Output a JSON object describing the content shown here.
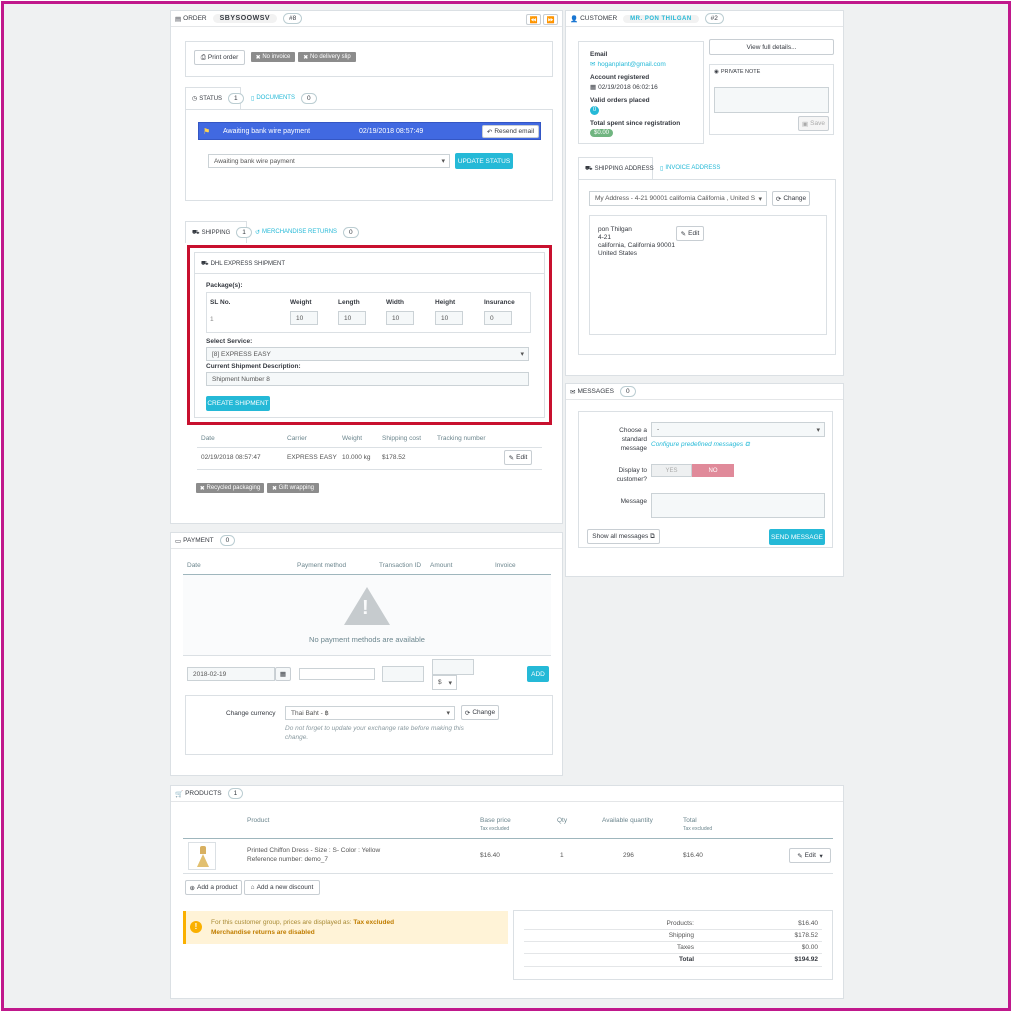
{
  "order": {
    "header_label": "ORDER",
    "reference": "SBYSOOWSV",
    "number": "#8",
    "print_label": "Print order",
    "no_invoice": "No invoice",
    "no_delivery": "No delivery slip",
    "tab_status": "STATUS",
    "tab_status_count": "1",
    "tab_documents": "DOCUMENTS",
    "tab_documents_count": "0",
    "status_name": "Awaiting bank wire payment",
    "status_date": "02/19/2018 08:57:49",
    "resend_label": "Resend email",
    "status_select": "Awaiting bank wire payment",
    "update_status_label": "UPDATE STATUS"
  },
  "shipping": {
    "tab_shipping": "SHIPPING",
    "tab_shipping_count": "1",
    "tab_returns": "MERCHANDISE RETURNS",
    "tab_returns_count": "0",
    "dhl_title": "DHL EXPRESS SHIPMENT",
    "packages_label": "Package(s):",
    "col_sl": "SL No.",
    "col_weight": "Weight",
    "col_length": "Length",
    "col_width": "Width",
    "col_height": "Height",
    "col_insurance": "Insurance",
    "row_sl": "1",
    "row_weight": "10",
    "row_length": "10",
    "row_width": "10",
    "row_height": "10",
    "row_insurance": "0",
    "select_service_label": "Select Service:",
    "service_value": "[8] EXPRESS EASY",
    "desc_label": "Current Shipment Description:",
    "desc_value": "Shipment Number 8",
    "create_label": "CREATE SHIPMENT",
    "table_headers": [
      "Date",
      "Carrier",
      "Weight",
      "Shipping cost",
      "Tracking number"
    ],
    "row_date": "02/19/2018 08:57:47",
    "row_carrier": "EXPRESS EASY",
    "row_weight_kg": "10.000 kg",
    "row_cost": "$178.52",
    "edit_label": "Edit",
    "recycled": "Recycled packaging",
    "gift": "Gift wrapping"
  },
  "payment": {
    "header_label": "PAYMENT",
    "count": "0",
    "headers": [
      "Date",
      "Payment method",
      "Transaction ID",
      "Amount",
      "Invoice"
    ],
    "empty_text": "No payment methods are available",
    "date_value": "2018-02-19",
    "currency_symbol": "$",
    "add_label": "ADD",
    "change_currency_label": "Change currency",
    "currency_value": "Thai Baht - ฿",
    "change_label": "Change",
    "note": "Do not forget to update your exchange rate before making this change."
  },
  "customer": {
    "header_label": "CUSTOMER",
    "name": "MR. PON THILGAN",
    "number": "#2",
    "view_details": "View full details...",
    "email_label": "Email",
    "email_value": "hoganplant@gmail.com",
    "registered_label": "Account registered",
    "registered_value": "02/19/2018 06:02:16",
    "valid_orders_label": "Valid orders placed",
    "valid_orders_value": "0",
    "total_spent_label": "Total spent since registration",
    "total_spent_value": "$0.00",
    "private_note_label": "PRIVATE NOTE",
    "save_label": "Save",
    "tab_shipping_address": "SHIPPING ADDRESS",
    "tab_invoice_address": "INVOICE ADDRESS",
    "address_select": "My Address - 4-21 90001 california California , United S",
    "change_label": "Change",
    "address_lines": [
      "pon Thilgan",
      "4-21",
      "california, California 90001",
      "United States"
    ],
    "edit_label": "Edit"
  },
  "messages": {
    "header_label": "MESSAGES",
    "count": "0",
    "choose_label_1": "Choose a",
    "choose_label_2": "standard",
    "choose_label_3": "message",
    "choose_value": "-",
    "configure_link": "Configure predefined messages",
    "display_label_1": "Display to",
    "display_label_2": "customer?",
    "yes_label": "YES",
    "no_label": "NO",
    "message_label": "Message",
    "show_all_label": "Show all messages",
    "send_label": "SEND MESSAGE"
  },
  "products": {
    "header_label": "PRODUCTS",
    "count": "1",
    "col_product": "Product",
    "col_base_price": "Base price",
    "col_base_sub": "Tax excluded",
    "col_qty": "Qty",
    "col_available": "Available quantity",
    "col_total": "Total",
    "col_total_sub": "Tax excluded",
    "product_name": "Printed Chiffon Dress - Size : S- Color : Yellow",
    "product_ref": "Reference number: demo_7",
    "product_price": "$16.40",
    "product_qty": "1",
    "product_available": "296",
    "product_total": "$16.40",
    "edit_label": "Edit",
    "add_product": "Add a product",
    "add_discount": "Add a new discount",
    "notice_prefix": "For this customer group, prices are displayed as:",
    "notice_tax": "Tax excluded",
    "notice_returns": "Merchandise returns are disabled",
    "summary_labels": [
      "Products:",
      "Shipping",
      "Taxes",
      "Total"
    ],
    "summary_values": [
      "$16.40",
      "$178.52",
      "$0.00",
      "$194.92"
    ]
  },
  "colors": {
    "accent": "#25b9d7",
    "status_bar": "#4169e1",
    "highlight_border": "#c8102e",
    "frame_border": "#c0188c",
    "no_toggle": "#e08a9a",
    "success": "#70b580",
    "warning_bg": "#fff3d7"
  }
}
